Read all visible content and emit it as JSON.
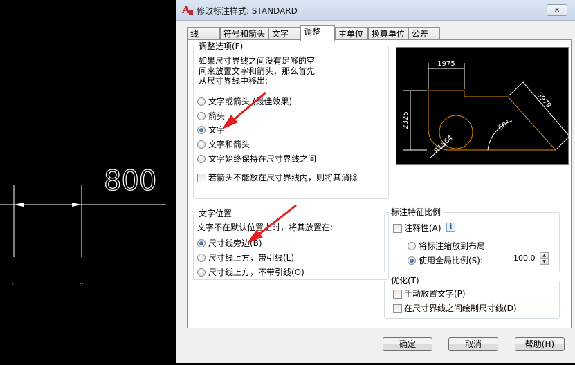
{
  "canvas": {
    "dimension_text": "800"
  },
  "dialog": {
    "title": "修改标注样式: STANDARD",
    "close_label": "✕",
    "tabs": [
      {
        "label": "线"
      },
      {
        "label": "符号和箭头"
      },
      {
        "label": "文字"
      },
      {
        "label": "调整",
        "active": true
      },
      {
        "label": "主单位"
      },
      {
        "label": "换算单位"
      },
      {
        "label": "公差"
      }
    ],
    "fit_options": {
      "legend": "调整选项(F)",
      "description": [
        "如果尺寸界线之间没有足够的空",
        "间来放置文字和箭头，那么首先",
        "从尺寸界线中移出:"
      ],
      "radios": [
        {
          "label": "文字或箭头 (最佳效果)",
          "checked": false
        },
        {
          "label": "箭头",
          "checked": false
        },
        {
          "label": "文字",
          "checked": true
        },
        {
          "label": "文字和箭头",
          "checked": false
        },
        {
          "label": "文字始终保持在尺寸界线之间",
          "checked": false
        }
      ],
      "suppress_checkbox": {
        "label": "若箭头不能放在尺寸界线内，则将其消除",
        "checked": false
      }
    },
    "text_placement": {
      "legend": "文字位置",
      "description": "文字不在默认位置上时，将其放置在:",
      "radios": [
        {
          "label": "尺寸线旁边(B)",
          "checked": true
        },
        {
          "label": "尺寸线上方，带引线(L)",
          "checked": false
        },
        {
          "label": "尺寸线上方，不带引线(O)",
          "checked": false
        }
      ]
    },
    "scale": {
      "legend": "标注特征比例",
      "annotative": {
        "label": "注释性(A)",
        "checked": false,
        "info_icon": "i"
      },
      "radios": [
        {
          "label": "将标注缩放到布局",
          "checked": false
        },
        {
          "label": "使用全局比例(S):",
          "checked": true
        }
      ],
      "scale_value": "100.0"
    },
    "fine_tuning": {
      "legend": "优化(T)",
      "checkboxes": [
        {
          "label": "手动放置文字(P)",
          "checked": false
        },
        {
          "label": "在尺寸界线之间绘制尺寸线(D)",
          "checked": false
        }
      ]
    },
    "preview": {
      "dim_top": "1975",
      "dim_left": "2325",
      "dim_right": "3979",
      "dim_radius": "R1564",
      "dim_angle": "60°"
    },
    "buttons": {
      "ok": "确定",
      "cancel": "取消",
      "help": "帮助(H)"
    }
  },
  "colors": {
    "annotation_arrow": "#e02020",
    "preview_geometry": "#e08a00"
  }
}
